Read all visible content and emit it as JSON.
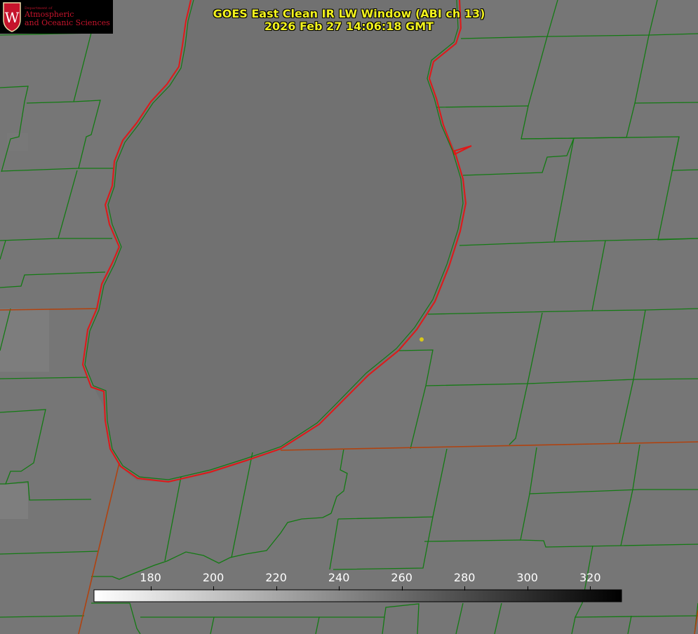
{
  "logo": {
    "department": "Department of",
    "line1": "Atmospheric",
    "line2": "and Oceanic Sciences",
    "crest_letter": "W",
    "brand_color": "#c5142c"
  },
  "title": {
    "line1": "GOES East Clean IR LW Window (ABI ch 13)",
    "line2": "2026 Feb 27 14:06:18 GMT",
    "color": "#f2f21e"
  },
  "map": {
    "background_color": "#767676",
    "boundary_color": "#137a13",
    "coastline_color": "#e01818",
    "state_border_color": "#b0420f",
    "station_marker_color": "#d8c81a"
  },
  "colorbar": {
    "ticks": [
      180,
      200,
      220,
      240,
      260,
      280,
      300,
      320
    ],
    "range": [
      162,
      330
    ],
    "gradient": "white-to-black"
  }
}
